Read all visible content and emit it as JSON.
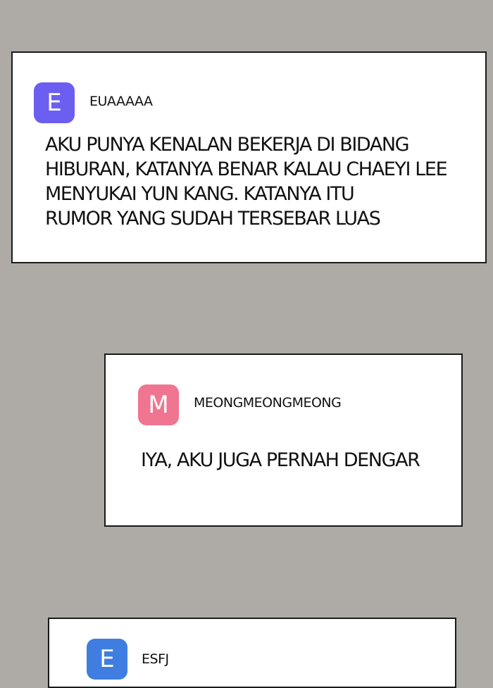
{
  "posts": [
    {
      "avatar_letter": "E",
      "avatar_color": "#6c5ef0",
      "username": "EUAAAAA",
      "message_lines": [
        "AKU PUNYA KENALAN BEKERJA DI BIDANG",
        "HIBURAN, KATANYA BENAR KALAU CHAEYI LEE",
        "MENYUKAI YUN KANG. KATANYA ITU",
        "RUMOR YANG SUDAH TERSEBAR LUAS"
      ]
    },
    {
      "avatar_letter": "M",
      "avatar_color": "#f07590",
      "username": "MEONGMEONGMEONG",
      "message_lines": [
        "IYA, AKU JUGA PERNAH DENGAR"
      ]
    },
    {
      "avatar_letter": "E",
      "avatar_color": "#3f7ee0",
      "username": "ESFJ",
      "message_lines": []
    }
  ]
}
